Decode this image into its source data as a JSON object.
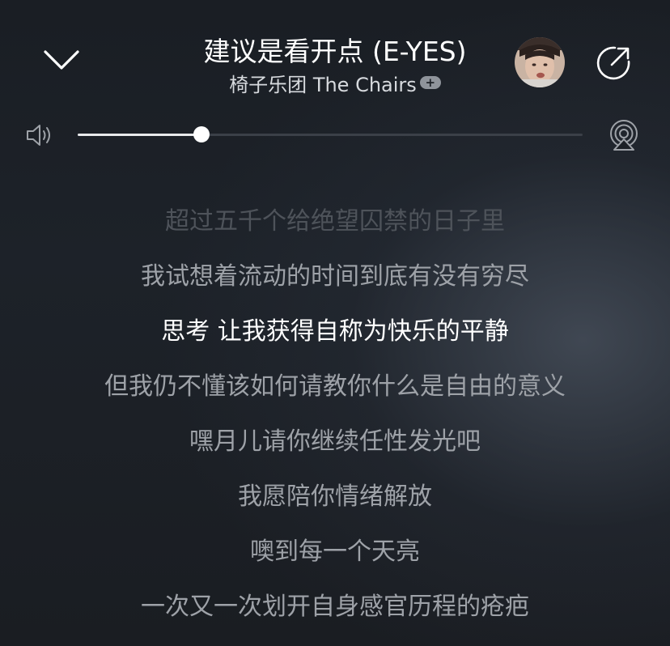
{
  "header": {
    "song_title": "建议是看开点 (E-YES)",
    "artist_name": "椅子乐团 The Chairs",
    "follow_badge": "+",
    "collapse_icon": "chevron-down-icon",
    "share_icon": "share-icon",
    "avatar": "artist-avatar"
  },
  "volume": {
    "level": 0.245,
    "speaker_icon": "speaker-icon",
    "airplay_icon": "airplay-icon"
  },
  "lyrics": [
    {
      "text": "超过五千个给绝望囚禁的日子里",
      "state": "faded"
    },
    {
      "text": "我试想着流动的时间到底有没有穷尽",
      "state": "normal"
    },
    {
      "text": "思考  让我获得自称为快乐的平静",
      "state": "current"
    },
    {
      "text": "但我仍不懂该如何请教你什么是自由的意义",
      "state": "normal"
    },
    {
      "text": "嘿月儿请你继续任性发光吧",
      "state": "normal"
    },
    {
      "text": "我愿陪你情绪解放",
      "state": "normal"
    },
    {
      "text": "噢到每一个天亮",
      "state": "normal"
    },
    {
      "text": "一次又一次划开自身感官历程的疮疤",
      "state": "normal"
    }
  ],
  "colors": {
    "background": "#1b1f25",
    "current_lyric": "#ffffff",
    "normal_lyric": "#9ea2a8",
    "faded_lyric": "#4e535a",
    "accent_knob": "#ffffff"
  }
}
